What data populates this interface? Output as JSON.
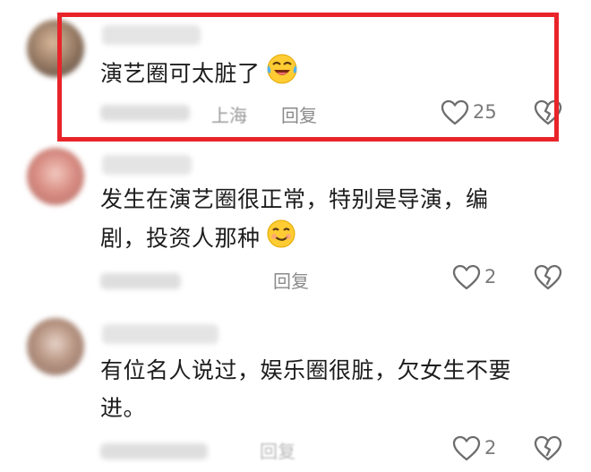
{
  "comments": [
    {
      "text": "演艺圈可太脏了",
      "location": "上海",
      "reply_label": "回复",
      "likes": "25",
      "emoji": "laughing-crying-emoji"
    },
    {
      "text_line1": "发生在演艺圈很正常，特别是导演，编",
      "text_line2": "剧，投资人那种",
      "reply_label": "回复",
      "likes": "2",
      "emoji": "smirking-emoji"
    },
    {
      "text_line1": "有位名人说过，娱乐圈很脏，欠女生不要",
      "text_line2": "进。",
      "reply_label": "回复",
      "likes": "2"
    }
  ],
  "colors": {
    "highlight": "#e8242a",
    "text": "#1d1d1d",
    "meta": "#8a8a8a"
  }
}
